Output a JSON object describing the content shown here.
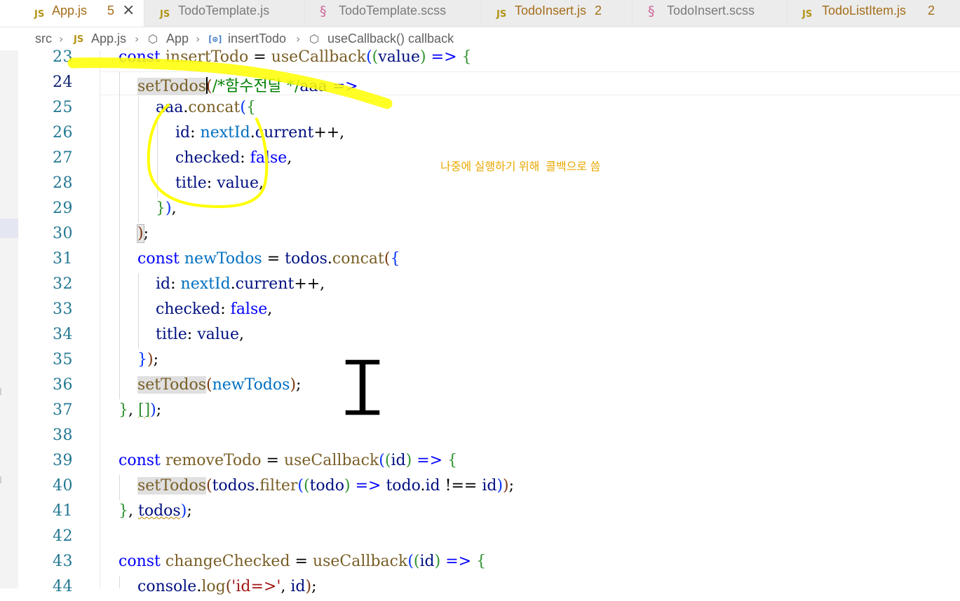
{
  "tabs": [
    {
      "label": "App.js",
      "icon": "js-icon",
      "badge": "5",
      "close": "×",
      "active": true
    },
    {
      "label": "TodoTemplate.js",
      "icon": "js-icon",
      "badge": "",
      "active": false
    },
    {
      "label": "TodoTemplate.scss",
      "icon": "sass-icon",
      "badge": "",
      "active": false
    },
    {
      "label": "TodoInsert.js",
      "icon": "js-icon",
      "badge": "2",
      "active": false
    },
    {
      "label": "TodoInsert.scss",
      "icon": "sass-icon",
      "badge": "",
      "active": false
    },
    {
      "label": "TodoListItem.js",
      "icon": "js-icon",
      "badge": "2",
      "active": false
    }
  ],
  "icons": {
    "js": "JS",
    "sass": "§",
    "separator": "›",
    "component": "⬡",
    "variable": "[⊙]"
  },
  "breadcrumb": {
    "src": "src",
    "file": "App.js",
    "component": "App",
    "variable": "insertTodo",
    "callback": "useCallback() callback"
  },
  "editor": {
    "current_line": 24,
    "line_numbers": [
      "23",
      "24",
      "25",
      "26",
      "27",
      "28",
      "29",
      "30",
      "31",
      "32",
      "33",
      "34",
      "35",
      "36",
      "37",
      "38",
      "39",
      "40",
      "41",
      "42",
      "43",
      "44"
    ]
  },
  "annotation": {
    "note": "나중에 실행하기 위해  콜백으로 씀",
    "highlight_color": "#ffff00"
  },
  "colors": {
    "keyword": "#0000ff",
    "function": "#795e26",
    "variable": "#001080",
    "constant": "#0070c1",
    "line_number": "#237893",
    "tab_js_icon": "#b39416",
    "tab_sass_icon": "#cd6799"
  }
}
